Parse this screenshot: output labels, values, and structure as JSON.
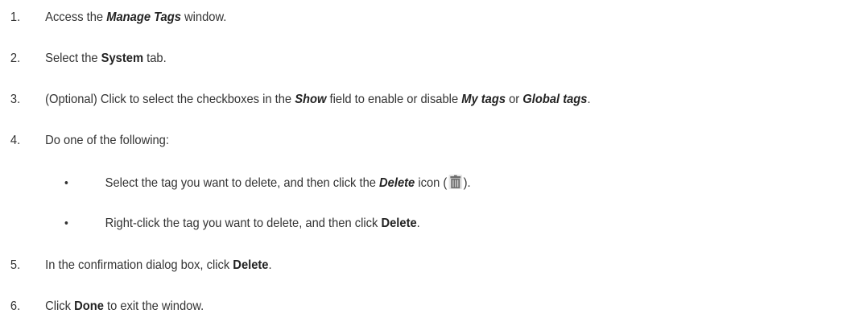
{
  "steps": [
    {
      "number": "1.",
      "parts": [
        {
          "text": "Access the ",
          "style": "normal"
        },
        {
          "text": "Manage Tags",
          "style": "italic"
        },
        {
          "text": " window.",
          "style": "normal"
        }
      ]
    },
    {
      "number": "2.",
      "parts": [
        {
          "text": "Select the ",
          "style": "normal"
        },
        {
          "text": "System",
          "style": "bold"
        },
        {
          "text": " tab.",
          "style": "normal"
        }
      ]
    },
    {
      "number": "3.",
      "parts": [
        {
          "text": "(Optional) Click to select the checkboxes in the ",
          "style": "normal"
        },
        {
          "text": "Show",
          "style": "italic"
        },
        {
          "text": " field to enable or disable ",
          "style": "normal"
        },
        {
          "text": "My tags",
          "style": "italic"
        },
        {
          "text": " or ",
          "style": "normal"
        },
        {
          "text": "Global tags",
          "style": "italic"
        },
        {
          "text": ".",
          "style": "normal"
        }
      ]
    },
    {
      "number": "4.",
      "parts": [
        {
          "text": "Do one of the following:",
          "style": "normal"
        }
      ],
      "bullets": [
        {
          "symbol": "•",
          "parts": [
            {
              "text": "Select the tag you want to delete, and then click the ",
              "style": "normal"
            },
            {
              "text": "Delete",
              "style": "italic"
            },
            {
              "text": " icon (",
              "style": "normal"
            },
            {
              "icon": "trash-icon"
            },
            {
              "text": ").",
              "style": "normal"
            }
          ]
        },
        {
          "symbol": "•",
          "parts": [
            {
              "text": "Right-click the tag you want to delete, and then click ",
              "style": "normal"
            },
            {
              "text": "Delete",
              "style": "bold"
            },
            {
              "text": ".",
              "style": "normal"
            }
          ]
        }
      ]
    },
    {
      "number": "5.",
      "parts": [
        {
          "text": "In the confirmation dialog box, click ",
          "style": "normal"
        },
        {
          "text": "Delete",
          "style": "bold"
        },
        {
          "text": ".",
          "style": "normal"
        }
      ]
    },
    {
      "number": "6.",
      "parts": [
        {
          "text": "Click ",
          "style": "normal"
        },
        {
          "text": "Done",
          "style": "bold"
        },
        {
          "text": " to exit the window.",
          "style": "normal"
        }
      ]
    }
  ],
  "colors": {
    "text": "#333333",
    "emphasis": "#222222",
    "icon": "#6f6f6f"
  }
}
